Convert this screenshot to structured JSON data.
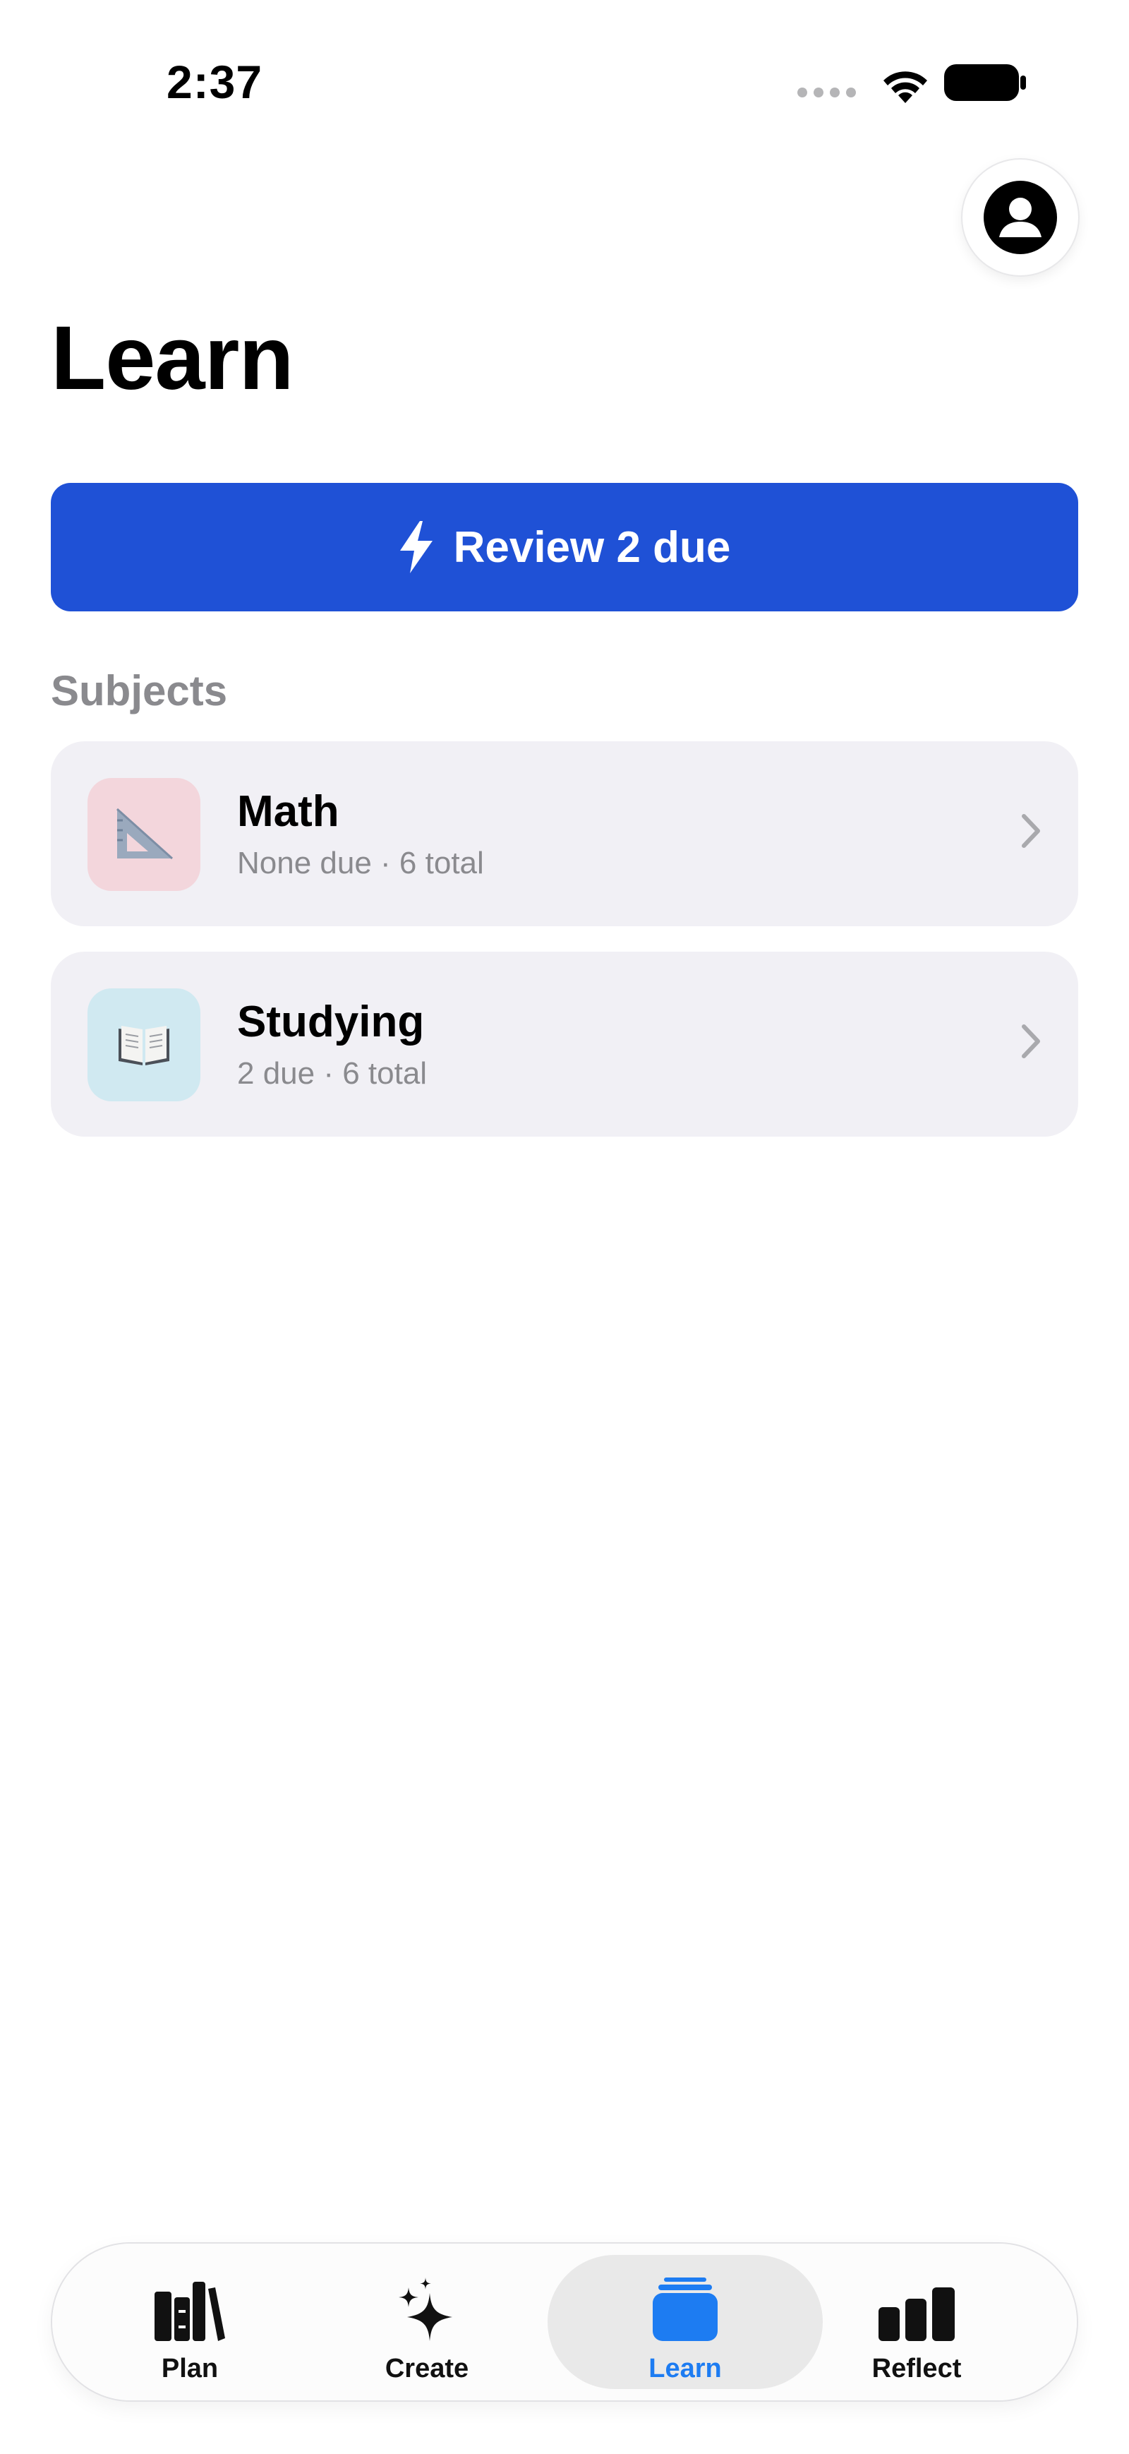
{
  "status_bar": {
    "time": "2:37"
  },
  "header": {
    "title": "Learn",
    "profile_icon": "person-circle-icon"
  },
  "review": {
    "label": "Review 2 due",
    "icon": "bolt-icon",
    "color": "#1f51d6"
  },
  "subjects": {
    "header": "Subjects",
    "items": [
      {
        "name": "Math",
        "meta": "None due · 6 total",
        "icon": "triangle-ruler-icon",
        "tile_color": "#f3d6dc"
      },
      {
        "name": "Studying",
        "meta": "2 due · 6 total",
        "icon": "open-book-icon",
        "tile_color": "#d0e9f1"
      }
    ]
  },
  "tab_bar": {
    "active_color": "#1d7cf2",
    "tabs": [
      {
        "label": "Plan",
        "icon": "books-icon",
        "active": false
      },
      {
        "label": "Create",
        "icon": "sparkles-icon",
        "active": false
      },
      {
        "label": "Learn",
        "icon": "card-stack-icon",
        "active": true
      },
      {
        "label": "Reflect",
        "icon": "bar-chart-icon",
        "active": false
      }
    ]
  }
}
